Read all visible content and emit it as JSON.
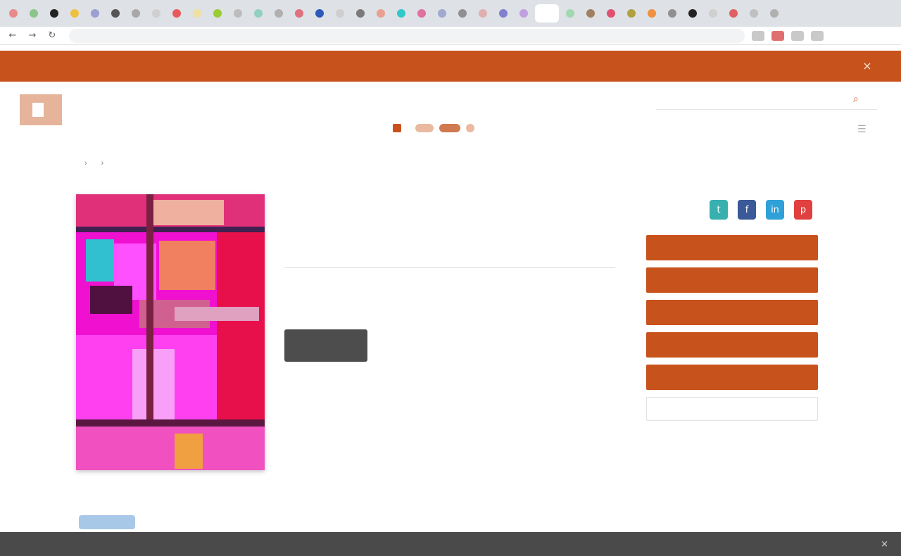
{
  "browser": {
    "tab_colors": [
      "#e88a8a",
      "#8bc58b",
      "#222222",
      "#f0c040",
      "#9aa0d0",
      "#555555",
      "#a8a8a8",
      "#cfcfcf",
      "#e85a5a",
      "#f0e0a0",
      "#9acd32",
      "#bcbcbc",
      "#8fd0c0",
      "#b0b0b0",
      "#e07080",
      "#2b5bb8",
      "#cfcfcf",
      "#7a7a7a",
      "#e8a090",
      "#30c8c8",
      "#e070a0",
      "#a0a8d0",
      "#909090",
      "#e0b0b0",
      "#8080d0",
      "#c0a0e0",
      "#ffffff",
      "#a0d8b0",
      "#a08060",
      "#e05070",
      "#b0a040",
      "#f09040",
      "#909090",
      "#222222",
      "#cfcfcf",
      "#e06060",
      "#c0c0c0",
      "#b0b0b0"
    ],
    "active_tab_index": 26,
    "back_glyph": "←",
    "forward_glyph": "→",
    "reload_glyph": "↻",
    "url": ""
  },
  "announcement": {
    "text": "",
    "link_text": "",
    "close_glyph": "×"
  },
  "header": {
    "logo_lines": [
      "",
      "",
      ""
    ],
    "search_placeholder": "",
    "search_glyph": "⌕",
    "nav": [
      {
        "label": "",
        "active": false
      },
      {
        "label": "",
        "active": false
      },
      {
        "label": "",
        "active": true
      },
      {
        "label": "",
        "active": false
      },
      {
        "label": "",
        "active": false
      },
      {
        "label": "",
        "active": false
      },
      {
        "label": "",
        "active": false
      },
      {
        "label": "",
        "active": false
      }
    ],
    "grid_glyph": "☰"
  },
  "breadcrumb": [
    "",
    "",
    ""
  ],
  "product": {
    "title_line1": "",
    "title_line2": "",
    "author": "",
    "description": "",
    "price_line": "",
    "price_sub": "",
    "cta_label": "",
    "meta": [
      "",
      "",
      "",
      "",
      ""
    ],
    "footnote": "",
    "cover_caption": [
      "",
      ""
    ]
  },
  "share": {
    "label": "",
    "icons": [
      {
        "name": "twitter-icon",
        "color": "#38b0b0",
        "glyph": "t"
      },
      {
        "name": "facebook-icon",
        "color": "#3b5998",
        "glyph": "f"
      },
      {
        "name": "linkedin-icon",
        "color": "#2fa0d8",
        "glyph": "in"
      },
      {
        "name": "pinterest-icon",
        "color": "#e04040",
        "glyph": "p"
      }
    ]
  },
  "actions": [
    {
      "label": "",
      "style": "primary"
    },
    {
      "label": "",
      "style": "primary"
    },
    {
      "label": "",
      "style": "primary"
    },
    {
      "label": "",
      "style": "primary"
    },
    {
      "label": "",
      "style": "primary"
    },
    {
      "label": "",
      "style": "outline"
    }
  ],
  "bottom_bar": {
    "text": "",
    "close_glyph": "×"
  },
  "colors": {
    "brand": "#c8521c",
    "dark_button": "#4d4d4d"
  }
}
